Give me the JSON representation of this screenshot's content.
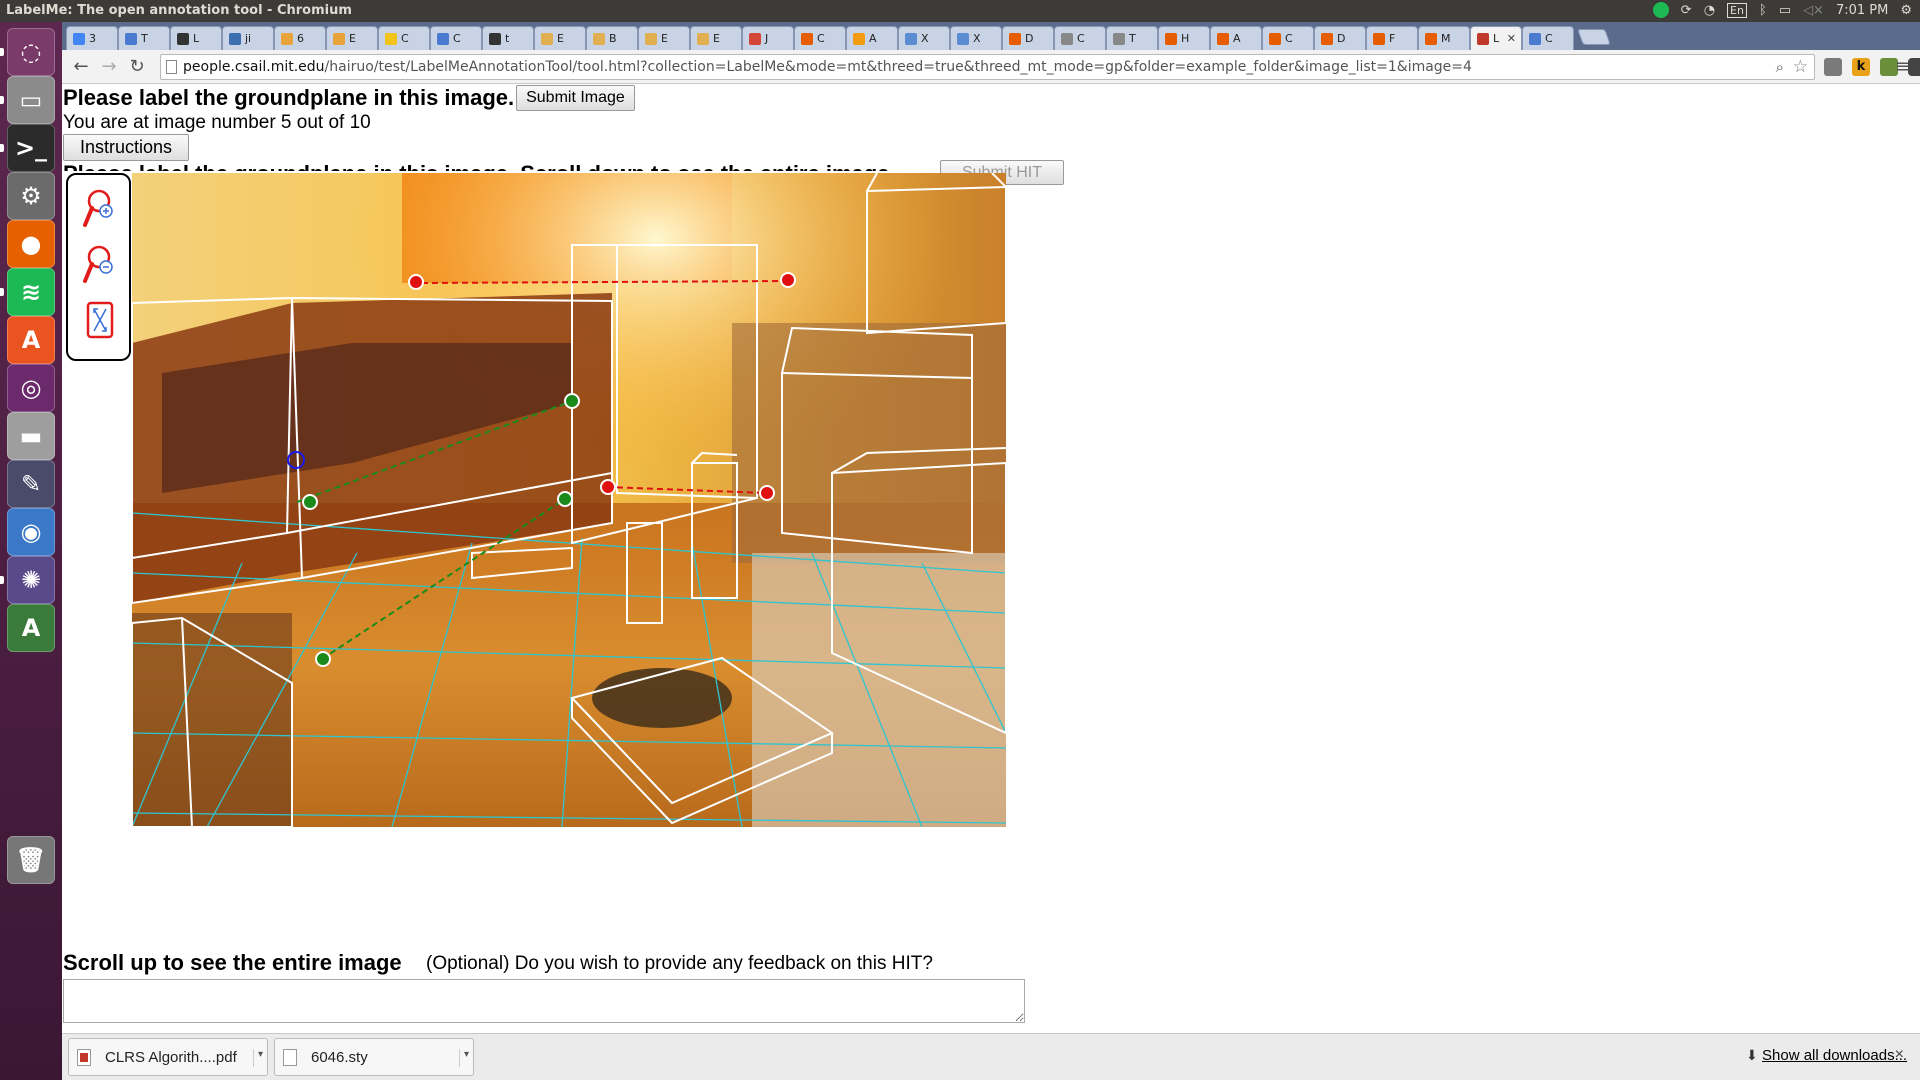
{
  "window": {
    "title": "LabelMe: The open annotation tool - Chromium",
    "clock": "7:01 PM",
    "keyboard_layout": "En"
  },
  "tabs": [
    {
      "label": "3",
      "color": "#4285f4"
    },
    {
      "label": "T",
      "color": "#4a7bd0"
    },
    {
      "label": "L",
      "color": "#333333"
    },
    {
      "label": "ji",
      "color": "#3d6fb0"
    },
    {
      "label": "6",
      "color": "#e8a33b"
    },
    {
      "label": "E",
      "color": "#e8a33b"
    },
    {
      "label": "C",
      "color": "#f0c419"
    },
    {
      "label": "C",
      "color": "#4a7bd0"
    },
    {
      "label": "t",
      "color": "#333333"
    },
    {
      "label": "E",
      "color": "#e0b050"
    },
    {
      "label": "B",
      "color": "#e0b050"
    },
    {
      "label": "E",
      "color": "#e0b050"
    },
    {
      "label": "E",
      "color": "#e0b050"
    },
    {
      "label": "J",
      "color": "#d44638"
    },
    {
      "label": "C",
      "color": "#e65c00"
    },
    {
      "label": "A",
      "color": "#f39c12"
    },
    {
      "label": "X",
      "color": "#5b8bd0"
    },
    {
      "label": "X",
      "color": "#5b8bd0"
    },
    {
      "label": "D",
      "color": "#e65c00"
    },
    {
      "label": "C",
      "color": "#888888"
    },
    {
      "label": "T",
      "color": "#888888"
    },
    {
      "label": "H",
      "color": "#e65c00"
    },
    {
      "label": "A",
      "color": "#e65c00"
    },
    {
      "label": "C",
      "color": "#e65c00"
    },
    {
      "label": "D",
      "color": "#e65c00"
    },
    {
      "label": "F",
      "color": "#e65c00"
    },
    {
      "label": "M",
      "color": "#e65c00"
    },
    {
      "label": "L",
      "color": "#c0392b",
      "active": true
    },
    {
      "label": "C",
      "color": "#4a7bd0"
    }
  ],
  "url": {
    "host": "people.csail.mit.edu",
    "path": "/hairuo/test/LabelMeAnnotationTool/tool.html?collection=LabelMe&mode=mt&threed=true&threed_mt_mode=gp&folder=example_folder&image_list=1&image=4"
  },
  "page": {
    "heading": "Please label the groundplane in this image.",
    "submit_image_label": "Submit Image",
    "image_position": "You are at image number 5 out of 10",
    "instructions_label": "Instructions",
    "clipped_heading": "Please label the groundplane in this image. Scroll down to see the entire image.",
    "submit_hit_label": "Submit HIT",
    "scroll_up": "Scroll up to see the entire image",
    "feedback_question": "(Optional) Do you wish to provide any feedback on this HIT?",
    "feedback_value": ""
  },
  "tools": [
    {
      "name": "zoom-in-icon"
    },
    {
      "name": "zoom-out-icon"
    },
    {
      "name": "fit-image-icon"
    }
  ],
  "downloads": {
    "items": [
      {
        "filename": "CLRS Algorith....pdf",
        "type": "pdf"
      },
      {
        "filename": "6046.sty",
        "type": "file"
      }
    ],
    "show_all": "Show all downloads..."
  },
  "launcher": [
    {
      "name": "dash-icon",
      "color": "#7a3b6b",
      "glyph": "◌"
    },
    {
      "name": "files-icon",
      "color": "#8b8b8b",
      "glyph": "▭"
    },
    {
      "name": "terminal-icon",
      "color": "#2b2b2b",
      "glyph": ">_"
    },
    {
      "name": "settings-icon",
      "color": "#6b6b6b",
      "glyph": "⚙"
    },
    {
      "name": "firefox-icon",
      "color": "#e66000",
      "glyph": "●"
    },
    {
      "name": "spotify-icon",
      "color": "#1db954",
      "glyph": "≋"
    },
    {
      "name": "software-center-icon",
      "color": "#e95420",
      "glyph": "A"
    },
    {
      "name": "unity-icon",
      "color": "#6a2a6b",
      "glyph": "◎"
    },
    {
      "name": "disk-icon",
      "color": "#9e9e9e",
      "glyph": "▬"
    },
    {
      "name": "inkscape-icon",
      "color": "#4a4a6a",
      "glyph": "✎"
    },
    {
      "name": "chromium-icon",
      "color": "#3b78c8",
      "glyph": "◉"
    },
    {
      "name": "shutter-icon",
      "color": "#5a4a8a",
      "glyph": "✺"
    },
    {
      "name": "updater-icon",
      "color": "#3a7a3a",
      "glyph": "A"
    },
    {
      "name": "trash-icon",
      "color": "#777777",
      "glyph": "🗑"
    }
  ],
  "colors": {
    "launcher_bg": "#5e2750",
    "ground_grid": "#2ec5d0",
    "box_outline": "#ffffff",
    "point_green": "#1a8a1a",
    "point_red": "#e01010",
    "point_blue": "#1a1aee"
  }
}
